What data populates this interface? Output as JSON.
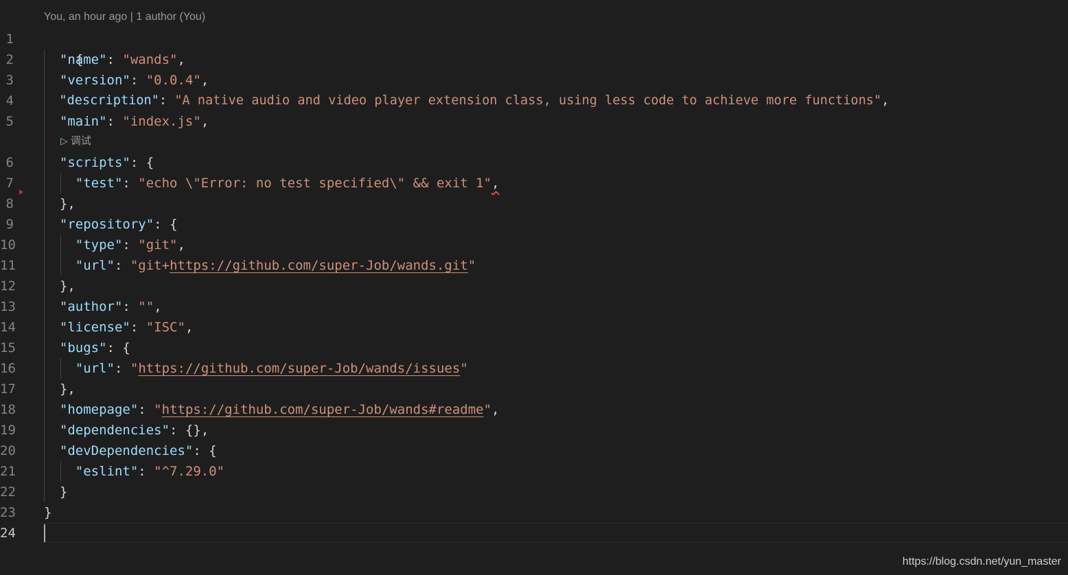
{
  "editor": {
    "codelens_author": "You, an hour ago | 1 author (You)",
    "debug_lens_label": "调试",
    "debug_lens_icon": "play-icon",
    "line_numbers": [
      "1",
      "2",
      "3",
      "4",
      "5",
      "6",
      "7",
      "8",
      "9",
      "10",
      "11",
      "12",
      "13",
      "14",
      "15",
      "16",
      "17",
      "18",
      "19",
      "20",
      "21",
      "22",
      "23",
      "24"
    ],
    "current_line": "24",
    "lines": {
      "l1": {
        "brace": "{"
      },
      "l2": {
        "key": "\"name\"",
        "sep": ": ",
        "val": "\"wands\"",
        "tail": ","
      },
      "l3": {
        "key": "\"version\"",
        "sep": ": ",
        "val": "\"0.0.4\"",
        "tail": ","
      },
      "l4": {
        "key": "\"description\"",
        "sep": ": ",
        "val": "\"A native audio and video player extension class, using less code to achieve more functions\"",
        "tail": ","
      },
      "l5": {
        "key": "\"main\"",
        "sep": ": ",
        "val": "\"index.js\"",
        "tail": ","
      },
      "l6": {
        "key": "\"scripts\"",
        "sep": ": ",
        "tail": "{"
      },
      "l7": {
        "key": "\"test\"",
        "sep": ": ",
        "val": "\"echo \\\"Error: no test specified\\\" && exit 1\"",
        "tail": ","
      },
      "l8": {
        "tail": "},"
      },
      "l9": {
        "key": "\"repository\"",
        "sep": ": ",
        "tail": "{"
      },
      "l10": {
        "key": "\"type\"",
        "sep": ": ",
        "val": "\"git\"",
        "tail": ","
      },
      "l11": {
        "key": "\"url\"",
        "sep": ": ",
        "val_prefix": "\"git+",
        "link": "https://github.com/super-Job/wands.git",
        "val_suffix": "\""
      },
      "l12": {
        "tail": "},"
      },
      "l13": {
        "key": "\"author\"",
        "sep": ": ",
        "val": "\"\"",
        "tail": ","
      },
      "l14": {
        "key": "\"license\"",
        "sep": ": ",
        "val": "\"ISC\"",
        "tail": ","
      },
      "l15": {
        "key": "\"bugs\"",
        "sep": ": ",
        "tail": "{"
      },
      "l16": {
        "key": "\"url\"",
        "sep": ": ",
        "val_prefix": "\"",
        "link": "https://github.com/super-Job/wands/issues",
        "val_suffix": "\""
      },
      "l17": {
        "tail": "},"
      },
      "l18": {
        "key": "\"homepage\"",
        "sep": ": ",
        "val_prefix": "\"",
        "link": "https://github.com/super-Job/wands#readme",
        "val_suffix": "\"",
        "tail": ","
      },
      "l19": {
        "key": "\"dependencies\"",
        "sep": ": ",
        "tail": "{},"
      },
      "l20": {
        "key": "\"devDependencies\"",
        "sep": ": ",
        "tail": "{"
      },
      "l21": {
        "key": "\"eslint\"",
        "sep": ": ",
        "val": "\"^7.29.0\""
      },
      "l22": {
        "tail": "}"
      },
      "l23": {
        "brace": "}"
      },
      "l24": {
        "brace": ""
      }
    }
  },
  "watermark": "https://blog.csdn.net/yun_master",
  "colors": {
    "background": "#1e1e1e",
    "key": "#9cdcfe",
    "string": "#ce9178",
    "punctuation": "#d4d4d4",
    "line_number": "#858585",
    "codelens": "#999999",
    "error_squiggle": "#f14c4c"
  }
}
